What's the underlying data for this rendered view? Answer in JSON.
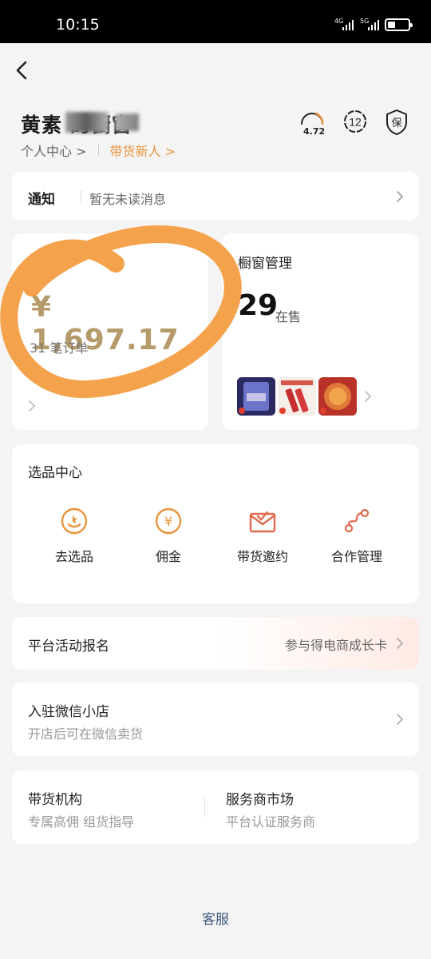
{
  "status_bar": {
    "time": "10:15",
    "net1": "4G",
    "net2": "5G"
  },
  "header": {
    "shop_title": "黄素 的橱窗",
    "personal_center": "个人中心 >",
    "seller_level": "带货新人 >",
    "score": "4.72",
    "rank_badge": "12",
    "guarantee_badge": "保"
  },
  "notice": {
    "title": "通知",
    "message": "暂无未读消息"
  },
  "revenue": {
    "amount": "¥ 1,697.17",
    "orders": "31 笔订单"
  },
  "window_manage": {
    "title": "橱窗管理",
    "count": "29",
    "unit": "在售"
  },
  "selection_center": {
    "title": "选品中心",
    "items": [
      {
        "label": "去选品",
        "icon": "select-product-icon"
      },
      {
        "label": "佣金",
        "icon": "commission-icon"
      },
      {
        "label": "带货邀约",
        "icon": "invitation-icon"
      },
      {
        "label": "合作管理",
        "icon": "cooperation-icon"
      }
    ]
  },
  "activity": {
    "title": "平台活动报名",
    "link": "参与得电商成长卡"
  },
  "wechat_shop": {
    "title": "入驻微信小店",
    "subtitle": "开店后可在微信卖货"
  },
  "services": {
    "agency": {
      "title": "带货机构",
      "subtitle": "专属高佣 组货指导"
    },
    "market": {
      "title": "服务商市场",
      "subtitle": "平台认证服务商"
    }
  },
  "footer": {
    "support": "客服"
  },
  "colors": {
    "accent_orange": "#e8943b",
    "revenue_gold": "#b59a6a",
    "link_blue": "#3f5a80",
    "icon_red": "#e06a4e"
  }
}
